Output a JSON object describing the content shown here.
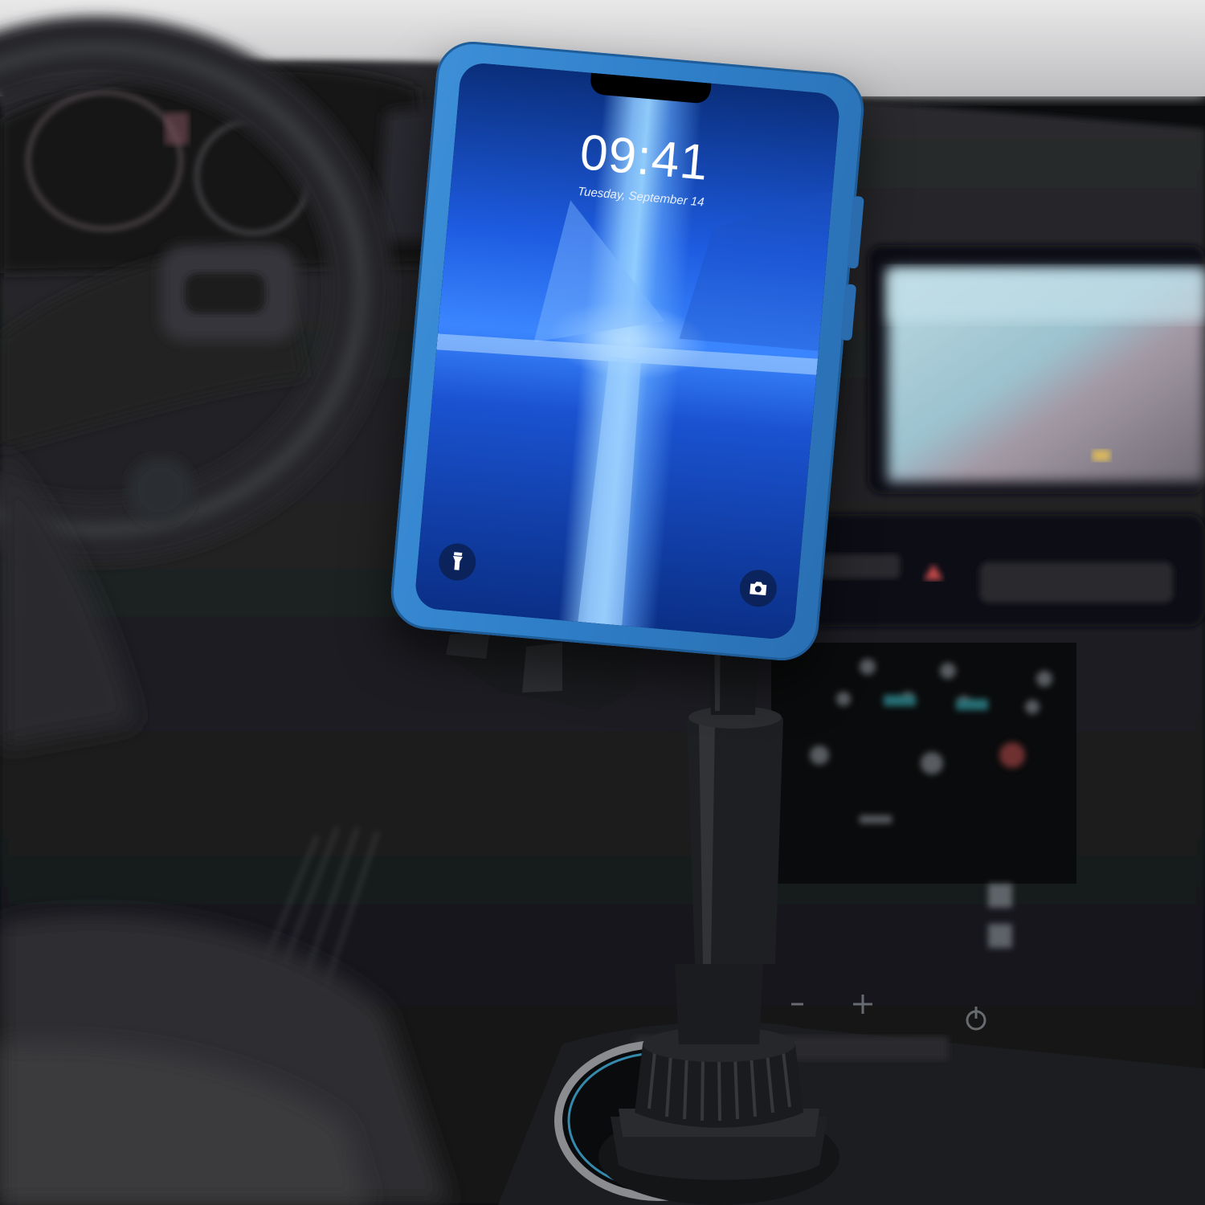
{
  "lock_screen": {
    "time": "09:41",
    "date": "Tuesday, September 14"
  },
  "icons": {
    "flashlight": "flashlight-icon",
    "camera": "camera-icon"
  },
  "colors": {
    "phone_case": "#3d8fd8",
    "screen_glow": "#3b86ff",
    "mount": "#1a1b1e",
    "cup_ring": "#3fa9d6"
  }
}
